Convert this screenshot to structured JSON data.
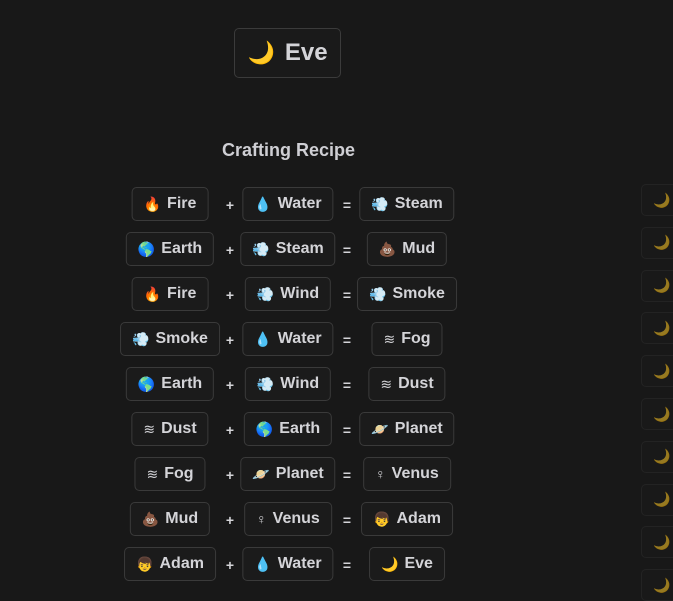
{
  "result": {
    "emoji": "🌙",
    "label": "Eve"
  },
  "heading": "Crafting Recipe",
  "operators": {
    "plus": "+",
    "equals": "="
  },
  "recipes": [
    {
      "a": {
        "emoji": "🔥",
        "label": "Fire"
      },
      "b": {
        "emoji": "💧",
        "label": "Water"
      },
      "r": {
        "emoji": "💨",
        "label": "Steam"
      }
    },
    {
      "a": {
        "emoji": "🌎",
        "label": "Earth"
      },
      "b": {
        "emoji": "💨",
        "label": "Steam"
      },
      "r": {
        "emoji": "💩",
        "label": "Mud"
      }
    },
    {
      "a": {
        "emoji": "🔥",
        "label": "Fire"
      },
      "b": {
        "emoji": "💨",
        "label": "Wind"
      },
      "r": {
        "emoji": "💨",
        "label": "Smoke"
      }
    },
    {
      "a": {
        "emoji": "💨",
        "label": "Smoke"
      },
      "b": {
        "emoji": "💧",
        "label": "Water"
      },
      "r": {
        "emoji": "≋",
        "label": "Fog"
      }
    },
    {
      "a": {
        "emoji": "🌎",
        "label": "Earth"
      },
      "b": {
        "emoji": "💨",
        "label": "Wind"
      },
      "r": {
        "emoji": "≋",
        "label": "Dust"
      }
    },
    {
      "a": {
        "emoji": "≋",
        "label": "Dust"
      },
      "b": {
        "emoji": "🌎",
        "label": "Earth"
      },
      "r": {
        "emoji": "🪐",
        "label": "Planet"
      }
    },
    {
      "a": {
        "emoji": "≋",
        "label": "Fog"
      },
      "b": {
        "emoji": "🪐",
        "label": "Planet"
      },
      "r": {
        "emoji": "♀",
        "label": "Venus"
      }
    },
    {
      "a": {
        "emoji": "💩",
        "label": "Mud"
      },
      "b": {
        "emoji": "♀",
        "label": "Venus"
      },
      "r": {
        "emoji": "👦",
        "label": "Adam"
      }
    },
    {
      "a": {
        "emoji": "👦",
        "label": "Adam"
      },
      "b": {
        "emoji": "💧",
        "label": "Water"
      },
      "r": {
        "emoji": "🌙",
        "label": "Eve"
      }
    }
  ],
  "side_items": [
    {
      "emoji": "🌙"
    },
    {
      "emoji": "🌙"
    },
    {
      "emoji": "🌙"
    },
    {
      "emoji": "🌙"
    },
    {
      "emoji": "🌙"
    },
    {
      "emoji": "🌙"
    },
    {
      "emoji": "🌙"
    },
    {
      "emoji": "🌙"
    },
    {
      "emoji": "🌙"
    },
    {
      "emoji": "🌙"
    }
  ]
}
